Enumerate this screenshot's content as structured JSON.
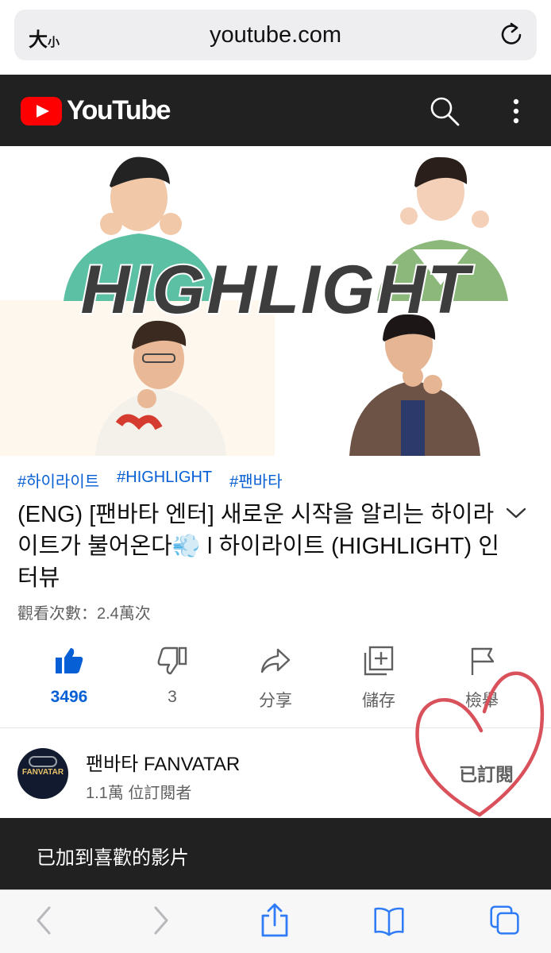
{
  "browser": {
    "text_size_button": "大",
    "text_size_small": "小",
    "url": "youtube.com"
  },
  "header": {
    "brand": "YouTube"
  },
  "thumbnail": {
    "overlay_text": "HIGHLIGHT"
  },
  "video": {
    "hashtags": [
      "#하이라이트",
      "#HIGHLIGHT",
      "#팬바타"
    ],
    "title": "(ENG) [팬바타 엔터] 새로운 시작을 알리는 하이라이트가 불어온다💨 l 하이라이트 (HIGHLIGHT) 인터뷰",
    "views": "觀看次數：2.4萬次"
  },
  "actions": [
    {
      "name": "like",
      "label": "3496",
      "icon": "thumbs-up-filled-icon"
    },
    {
      "name": "dislike",
      "label": "3",
      "icon": "thumbs-down-icon"
    },
    {
      "name": "share",
      "label": "分享",
      "icon": "share-arrow-icon"
    },
    {
      "name": "save",
      "label": "儲存",
      "icon": "add-to-playlist-icon"
    },
    {
      "name": "report",
      "label": "檢舉",
      "icon": "flag-icon"
    }
  ],
  "channel": {
    "name": "팬바타 FANVATAR",
    "subscribers": "1.1萬 位訂閱者",
    "avatar_text": "FANVATAR",
    "subscribe_label": "已訂閱"
  },
  "toast": {
    "message": "已加到喜歡的影片"
  },
  "colors": {
    "yt_red": "#ff0000",
    "header_bg": "#212121",
    "link_blue": "#065fd4",
    "heart_doodle": "#d9515a"
  }
}
